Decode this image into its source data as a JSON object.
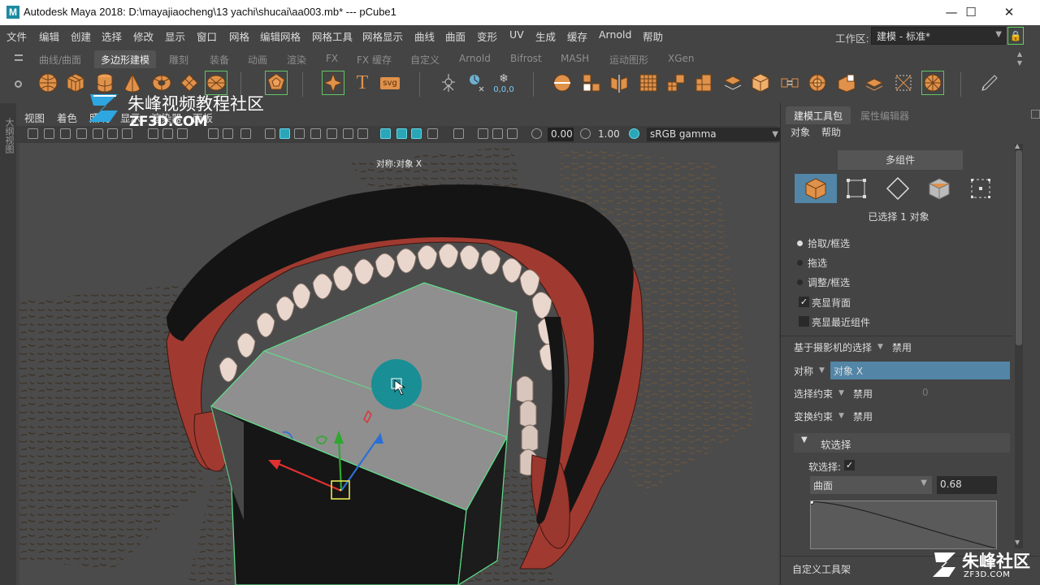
{
  "titlebar": {
    "logo_letter": "M",
    "title": "Autodesk Maya 2018: D:\\mayajiaocheng\\13 yachi\\shucai\\aa003.mb*   ---   pCube1"
  },
  "menubar": {
    "items": [
      "文件",
      "编辑",
      "创建",
      "选择",
      "修改",
      "显示",
      "窗口",
      "网格",
      "编辑网格",
      "网格工具",
      "网格显示",
      "曲线",
      "曲面",
      "变形",
      "UV",
      "生成",
      "缓存",
      "Arnold",
      "帮助"
    ],
    "workspace_label": "工作区:",
    "workspace_value": "建模 - 标准*"
  },
  "shelf": {
    "tabs": [
      "曲线/曲面",
      "多边形建模",
      "雕刻",
      "装备",
      "动画",
      "渲染",
      "FX",
      "FX 缓存",
      "自定义",
      "Arnold",
      "Bifrost",
      "MASH",
      "运动图形",
      "XGen"
    ],
    "active_tab_index": 1,
    "tool_zero_label": "0,0,0",
    "svg_label": "svg",
    "text_label": "T"
  },
  "left_strip": {
    "label": "大纲视图"
  },
  "panel": {
    "menus": [
      "视图",
      "着色",
      "照明",
      "显示",
      "渲染器",
      "面板"
    ],
    "exposure": "0.00",
    "gamma": "1.00",
    "colorspace": "sRGB gamma"
  },
  "viewport": {
    "hud": "对称:对象 X"
  },
  "watermark": {
    "title": "朱峰视频教程社区",
    "subtitle": "ZF3D.COM"
  },
  "right_panel": {
    "tabs": [
      "建模工具包",
      "属性编辑器"
    ],
    "menus": [
      "对象",
      "帮助"
    ],
    "multi_component": "多组件",
    "selected_count": "已选择 1 对象",
    "select_modes": [
      "拾取/框选",
      "拖选",
      "调整/框选"
    ],
    "checks": [
      "亮显背面",
      "亮显最近组件"
    ],
    "camera_based_label": "基于摄影机的选择",
    "camera_based_value": "禁用",
    "symmetry_label": "对称",
    "symmetry_value": "对象 X",
    "select_constraint_label": "选择约束",
    "select_constraint_value": "禁用",
    "select_constraint_num": "0",
    "transform_constraint_label": "变换约束",
    "transform_constraint_value": "禁用",
    "soft_select_section": "软选择",
    "soft_select_label": "软选择:",
    "falloff_mode": "曲面",
    "falloff_value": "0.68",
    "custom_shelf": "自定义工具架"
  },
  "brand": {
    "name": "朱峰社区",
    "url": "ZF3D.COM"
  },
  "colors": {
    "accent": "#5285a6",
    "highlight_green": "#62c462",
    "manip_cyan": "#138e96"
  }
}
